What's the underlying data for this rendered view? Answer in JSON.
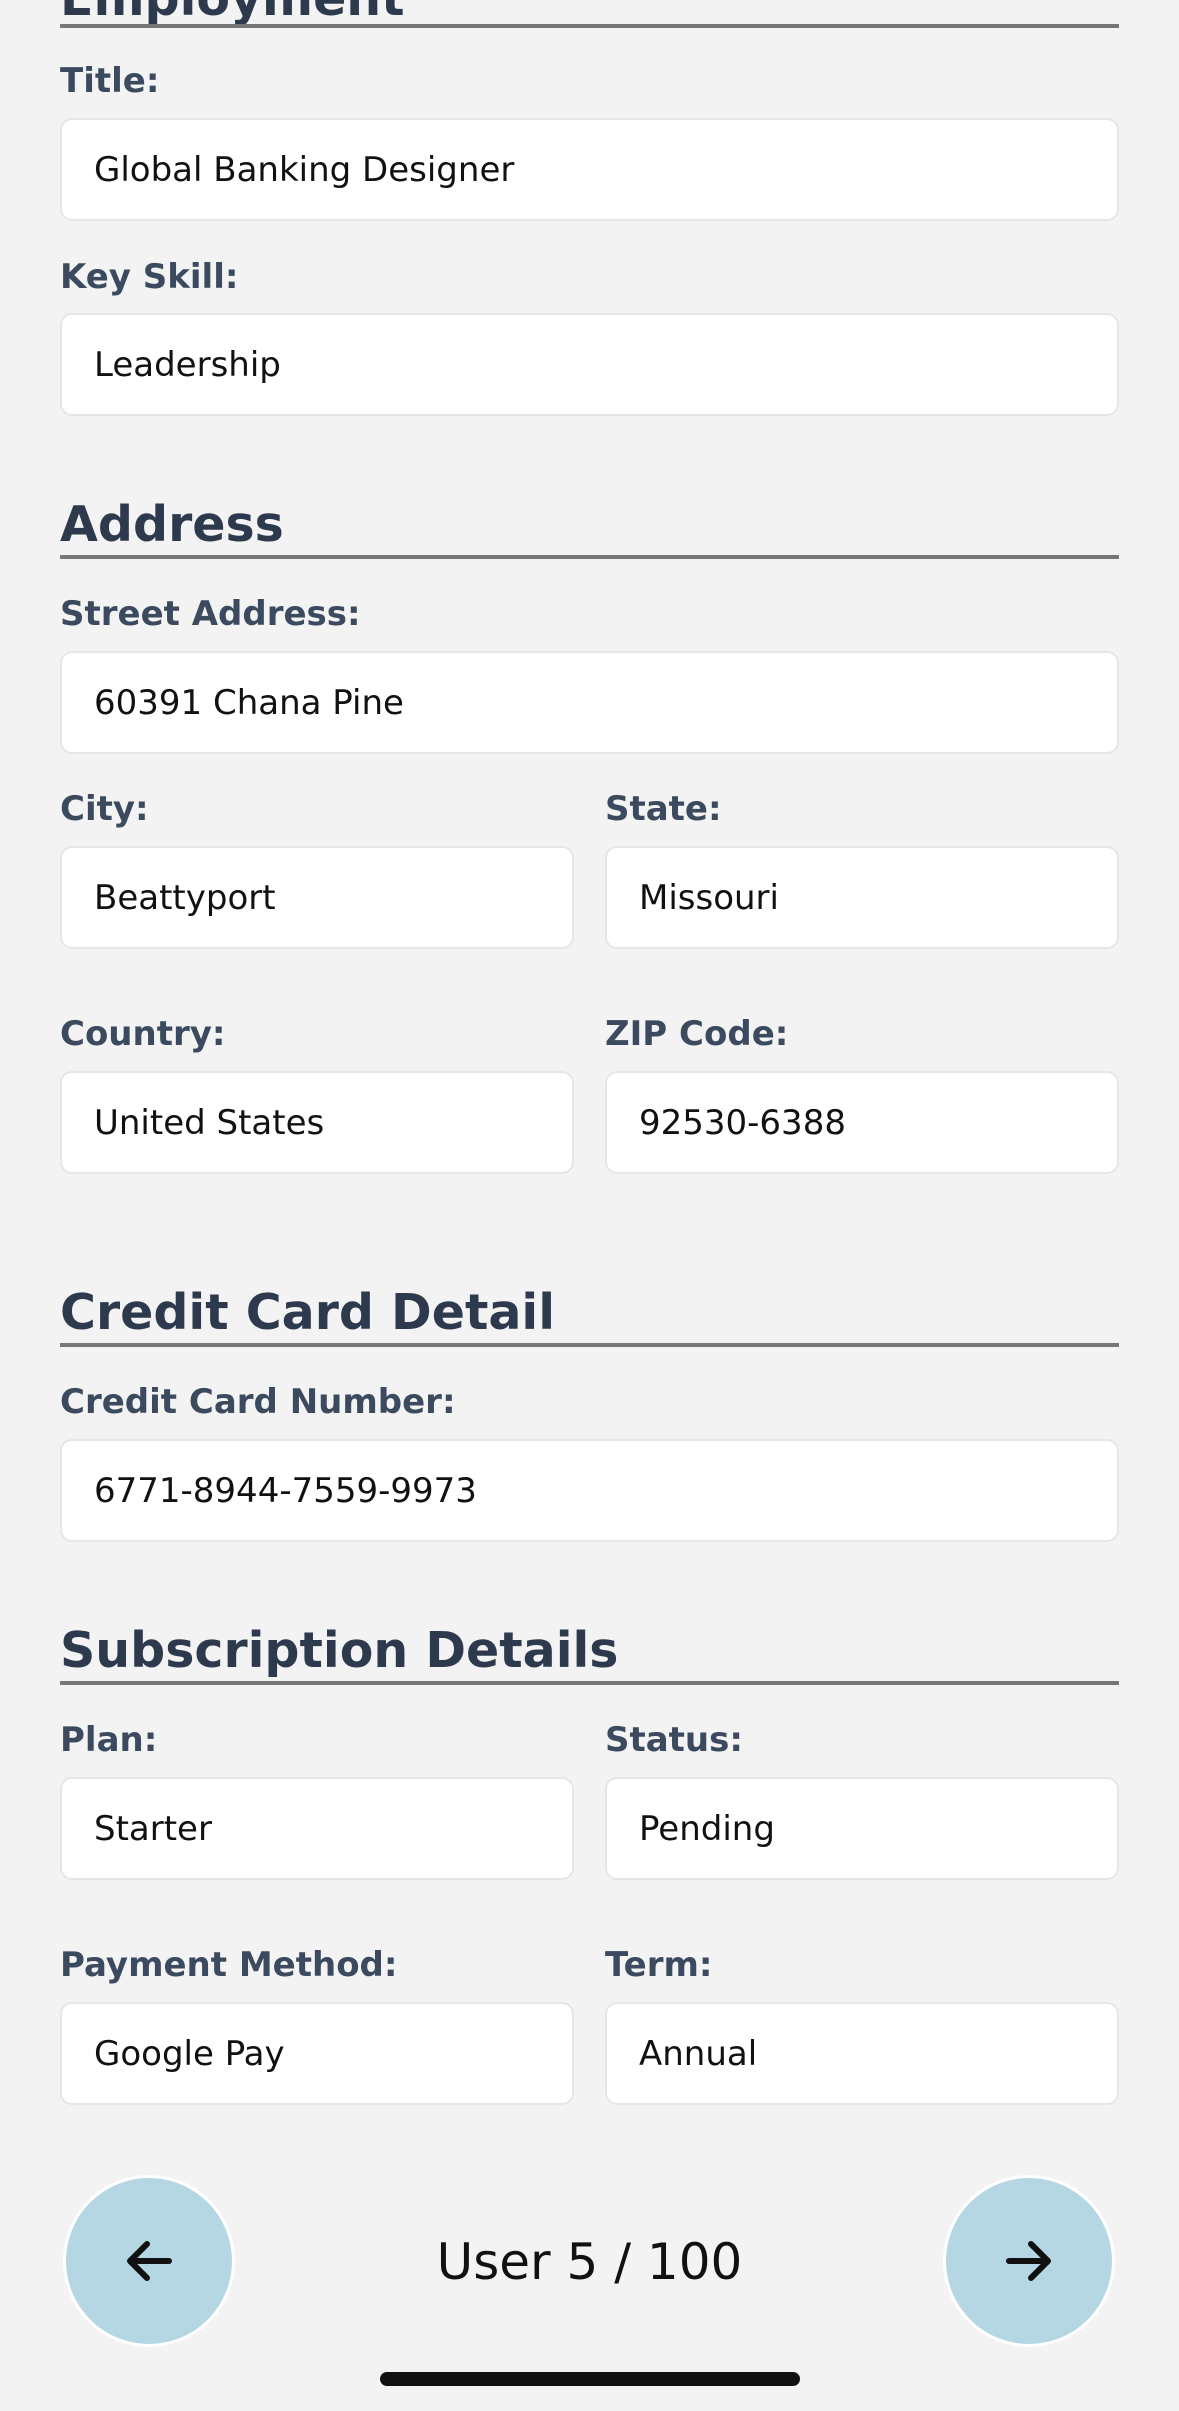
{
  "sections": {
    "employment": {
      "title": "Employment",
      "fields": {
        "title": {
          "label": "Title:",
          "value": "Global Banking Designer"
        },
        "key_skill": {
          "label": "Key Skill:",
          "value": "Leadership"
        }
      }
    },
    "address": {
      "title": "Address",
      "fields": {
        "street": {
          "label": "Street Address:",
          "value": "60391 Chana Pine"
        },
        "city": {
          "label": "City:",
          "value": "Beattyport"
        },
        "state": {
          "label": "State:",
          "value": "Missouri"
        },
        "country": {
          "label": "Country:",
          "value": "United States"
        },
        "zip": {
          "label": "ZIP Code:",
          "value": "92530-6388"
        }
      }
    },
    "credit_card": {
      "title": "Credit Card Detail",
      "fields": {
        "number": {
          "label": "Credit Card Number:",
          "value": "6771-8944-7559-9973"
        }
      }
    },
    "subscription": {
      "title": "Subscription Details",
      "fields": {
        "plan": {
          "label": "Plan:",
          "value": "Starter"
        },
        "status": {
          "label": "Status:",
          "value": "Pending"
        },
        "payment_method": {
          "label": "Payment Method:",
          "value": "Google Pay"
        },
        "term": {
          "label": "Term:",
          "value": "Annual"
        }
      }
    }
  },
  "pager": {
    "text": "User 5 / 100",
    "prev_icon": "arrow-left-icon",
    "next_icon": "arrow-right-icon"
  },
  "colors": {
    "background": "#f3f3f3",
    "heading": "#2d3a4d",
    "label": "#3b4a5e",
    "nav_button": "#b4d7e3"
  }
}
